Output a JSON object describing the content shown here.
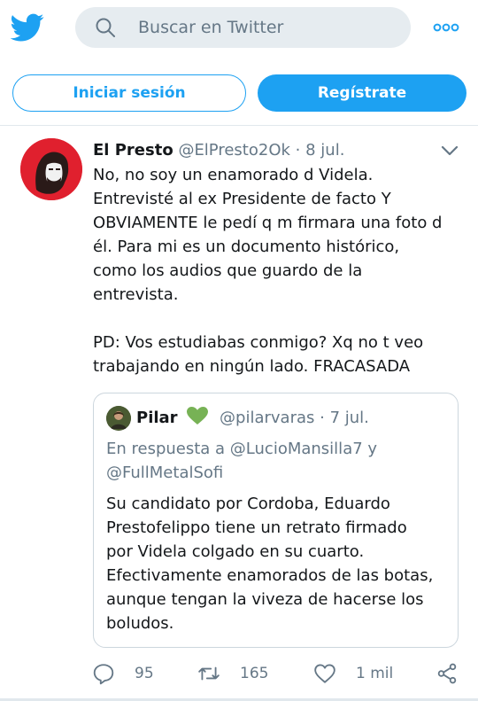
{
  "header": {
    "search_placeholder": "Buscar en Twitter",
    "login_label": "Iniciar sesión",
    "signup_label": "Regístrate"
  },
  "tweet": {
    "name": "El Presto",
    "handle": "@ElPresto2Ok",
    "separator": "·",
    "date": "8 jul.",
    "text": "No, no soy un enamorado d Videla.\nEntrevisté al ex Presidente de facto Y\nOBVIAMENTE le pedí q m firmara una foto d\nél. Para mi es un documento histórico,\ncomo los audios que guardo de la\nentrevista.\n\nPD: Vos estudiabas conmigo? Xq no t veo\ntrabajando en ningún lado. FRACASADA",
    "quoted": {
      "name": "Pilar",
      "handle": "@pilarvaras",
      "separator": "·",
      "date": "7 jul.",
      "reply_to": "En respuesta a @LucioMansilla7 y\n@FullMetalSofi",
      "text": "Su candidato por Cordoba, Eduardo\nPrestofelippo tiene un retrato firmado\npor Videla colgado en su cuarto.\nEfectivamente enamorados de las botas,\naunque tengan la viveza de hacerse los\nboludos."
    },
    "stats": {
      "replies": "95",
      "retweets": "165",
      "likes": "1 mil"
    }
  },
  "colors": {
    "brand": "#1da1f2",
    "text": "#14171a",
    "secondary": "#657786",
    "search_bg": "#e6ecf0",
    "avatar_bg": "#e0202e",
    "heart_green": "#77b255"
  },
  "icons": [
    "twitter-bird-icon",
    "search-icon",
    "more-dots-icon",
    "chevron-down-icon",
    "green-heart-icon",
    "reply-icon",
    "retweet-icon",
    "like-icon",
    "share-icon"
  ]
}
